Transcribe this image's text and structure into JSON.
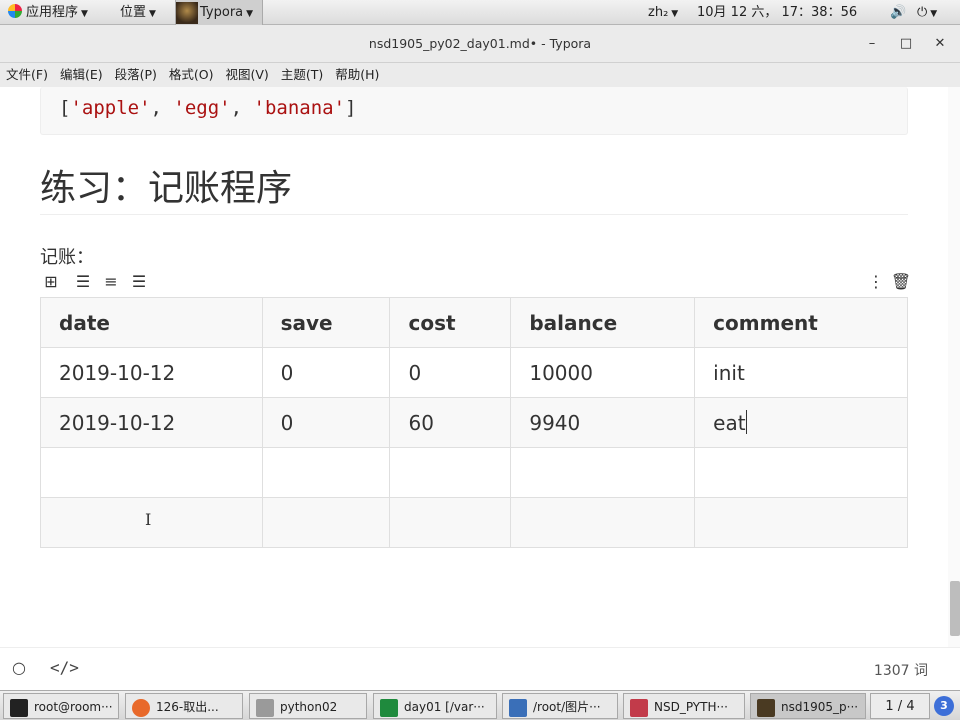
{
  "top_panel": {
    "apps_label": "应用程序",
    "places_label": "位置",
    "active_app": "Typora",
    "input_method": "zh₂",
    "datetime": "10月 12 六， 17：38：56"
  },
  "window": {
    "title": "nsd1905_py02_day01.md• - Typora",
    "minimize": "–",
    "maximize": "□",
    "close": "✕"
  },
  "menu": [
    "文件(F)",
    "编辑(E)",
    "段落(P)",
    "格式(O)",
    "视图(V)",
    "主题(T)",
    "帮助(H)"
  ],
  "document": {
    "code_open": "[",
    "code_items": [
      "'apple'",
      "'egg'",
      "'banana'"
    ],
    "code_sep": ", ",
    "code_close": "]",
    "heading": "练习：记账程序",
    "paragraph": "记账：",
    "table": {
      "headers": [
        "date",
        "save",
        "cost",
        "balance",
        "comment"
      ],
      "rows": [
        [
          "2019-10-12",
          "0",
          "0",
          "10000",
          "init"
        ],
        [
          "2019-10-12",
          "0",
          "60",
          "9940",
          "eat"
        ],
        [
          "",
          "",
          "",
          "",
          ""
        ],
        [
          "",
          "",
          "",
          "",
          ""
        ]
      ]
    }
  },
  "footer": {
    "word_count": "1307 词"
  },
  "taskbar": {
    "tasks": [
      {
        "label": "root@room···",
        "icon_color": "#222222"
      },
      {
        "label": "126-取出...",
        "icon_color": "#e8692a"
      },
      {
        "label": "python02",
        "icon_color": "#9a9a9a"
      },
      {
        "label": "day01 [/var···",
        "icon_color": "#1f8a3d"
      },
      {
        "label": "/root/图片···",
        "icon_color": "#3a6fb8"
      },
      {
        "label": "NSD_PYTH···",
        "icon_color": "#c23b4a"
      },
      {
        "label": "nsd1905_p···",
        "icon_color": "#4a3a22"
      }
    ],
    "workspace": "1 / 4",
    "badge": "3"
  }
}
